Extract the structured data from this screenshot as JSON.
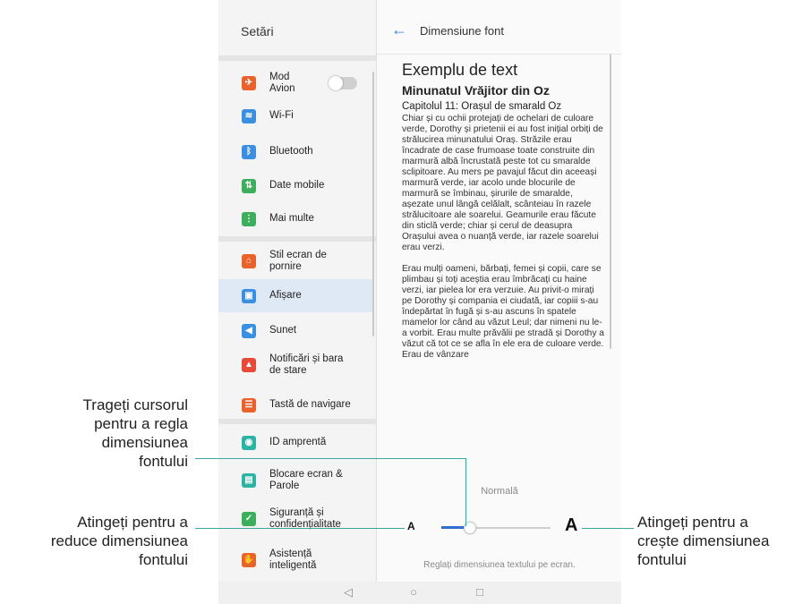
{
  "colors": {
    "accent": "#2f6fd0",
    "callout_line": "#3aa6a0",
    "selected_bg": "#dfe9f5"
  },
  "settings_pane": {
    "title": "Setări",
    "items": [
      {
        "label": "Mod\nAvion",
        "icon": "airplane-icon",
        "color": "#e8622c",
        "toggle": "off"
      },
      {
        "label": "Wi-Fi",
        "icon": "wifi-icon",
        "color": "#3b8fe0"
      },
      {
        "label": "Bluetooth",
        "icon": "bluetooth-icon",
        "color": "#3b8fe0"
      },
      {
        "label": "Date mobile",
        "icon": "mobile-data-icon",
        "color": "#3dae5b"
      },
      {
        "label": "Mai multe",
        "icon": "more-icon",
        "color": "#3dae5b"
      },
      {
        "label": "Stil ecran de\npornire",
        "icon": "home-style-icon",
        "color": "#e8622c"
      },
      {
        "label": "Afișare",
        "icon": "display-icon",
        "color": "#3b8fe0",
        "selected": true
      },
      {
        "label": "Sunet",
        "icon": "sound-icon",
        "color": "#3b8fe0"
      },
      {
        "label": "Notificări și bara\nde stare",
        "icon": "notification-icon",
        "color": "#e84a3a"
      },
      {
        "label": "Tastă de navigare",
        "icon": "nav-key-icon",
        "color": "#e8622c"
      },
      {
        "label": "ID amprentă",
        "icon": "fingerprint-icon",
        "color": "#2bb3a3"
      },
      {
        "label": "Blocare ecran &\nParole",
        "icon": "lock-icon",
        "color": "#2bb3a3"
      },
      {
        "label": "Siguranță și\nconfidențialitate",
        "icon": "shield-icon",
        "color": "#3dae5b"
      },
      {
        "label": "Asistență\ninteligentă",
        "icon": "hand-icon",
        "color": "#e8622c"
      }
    ]
  },
  "font_pane": {
    "title": "Dimensiune font",
    "back_icon": "back-arrow-icon",
    "preview": {
      "heading": "Exemplu de text",
      "book_title": "Minunatul Vrăjitor din Oz",
      "chapter": "Capitolul 11: Orașul de smarald Oz",
      "paragraph1": "Chiar și cu ochii protejați de ochelari de culoare verde, Dorothy și prietenii ei au fost inițial orbiți de strălucirea minunatului Oraș. Străzile erau încadrate de case frumoase toate construite din marmură albă încrustată peste tot cu smaralde sclipitoare. Au mers pe pavajul făcut din aceeași marmură verde, iar acolo unde blocurile de marmură se îmbinau, șirurile de smaralde, așezate unul lângă celălalt, scânteiau în razele strălucitoare ale soarelui. Geamurile erau făcute din sticlă verde; chiar și cerul de deasupra Orașului avea o nuanță verde, iar razele soarelui erau verzi.",
      "paragraph2": "Erau mulți oameni, bărbați, femei și copii, care se plimbau și toți aceștia erau îmbrăcați cu haine verzi, iar pielea lor era verzuie. Au privit-o mirați pe Dorothy și compania ei ciudată, iar copiii s-au îndepărtat în fugă și s-au ascuns în spatele mamelor lor când au văzut Leul; dar nimeni nu le-a vorbit. Erau multe prăvălii pe stradă și Dorothy a văzut că tot ce se afla în ele era de culoare verde. Erau de vânzare"
    },
    "size_label": "Normală",
    "decrease_label": "A",
    "increase_label": "A",
    "slider_level": 0.25,
    "hint": "Reglați dimensiunea textului pe ecran."
  },
  "navbar": {
    "back": "◁",
    "home": "○",
    "recent": "□"
  },
  "callouts": {
    "drag": "Trageți cursorul\npentru a regla\ndimensiunea\nfontului",
    "reduce": "Atingeți pentru a\nreduce dimensiunea\nfontului",
    "increase": "Atingeți pentru a\ncrește dimensiunea\nfontului"
  }
}
